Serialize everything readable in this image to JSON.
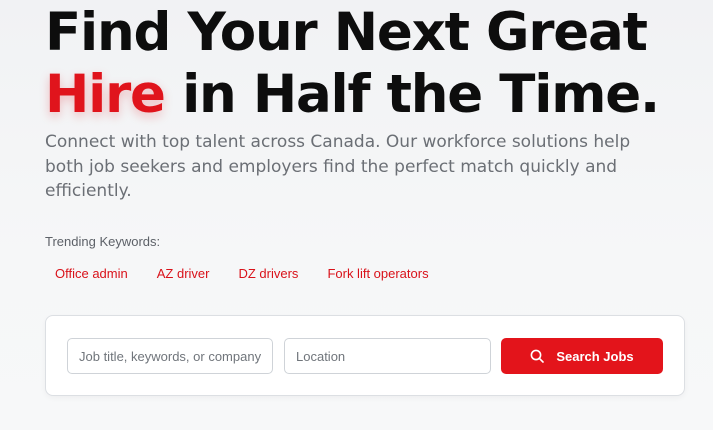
{
  "hero": {
    "headline_line1": "Find Your Next Great",
    "headline_accent": "Hire",
    "headline_rest": " in Half the Time.",
    "subtitle": "Connect with top talent across Canada. Our workforce solutions help both job seekers and employers find the perfect match quickly and efficiently."
  },
  "trending": {
    "label": "Trending Keywords:",
    "keywords": [
      "Office admin",
      "AZ driver",
      "DZ drivers",
      "Fork lift operators"
    ]
  },
  "search": {
    "keywords_placeholder": "Job title, keywords, or company",
    "location_placeholder": "Location",
    "button_label": "Search Jobs",
    "button_icon": "search-icon"
  },
  "colors": {
    "accent": "#e3141b",
    "headline": "#0d0d0d",
    "subtitle": "#6b6f75"
  }
}
